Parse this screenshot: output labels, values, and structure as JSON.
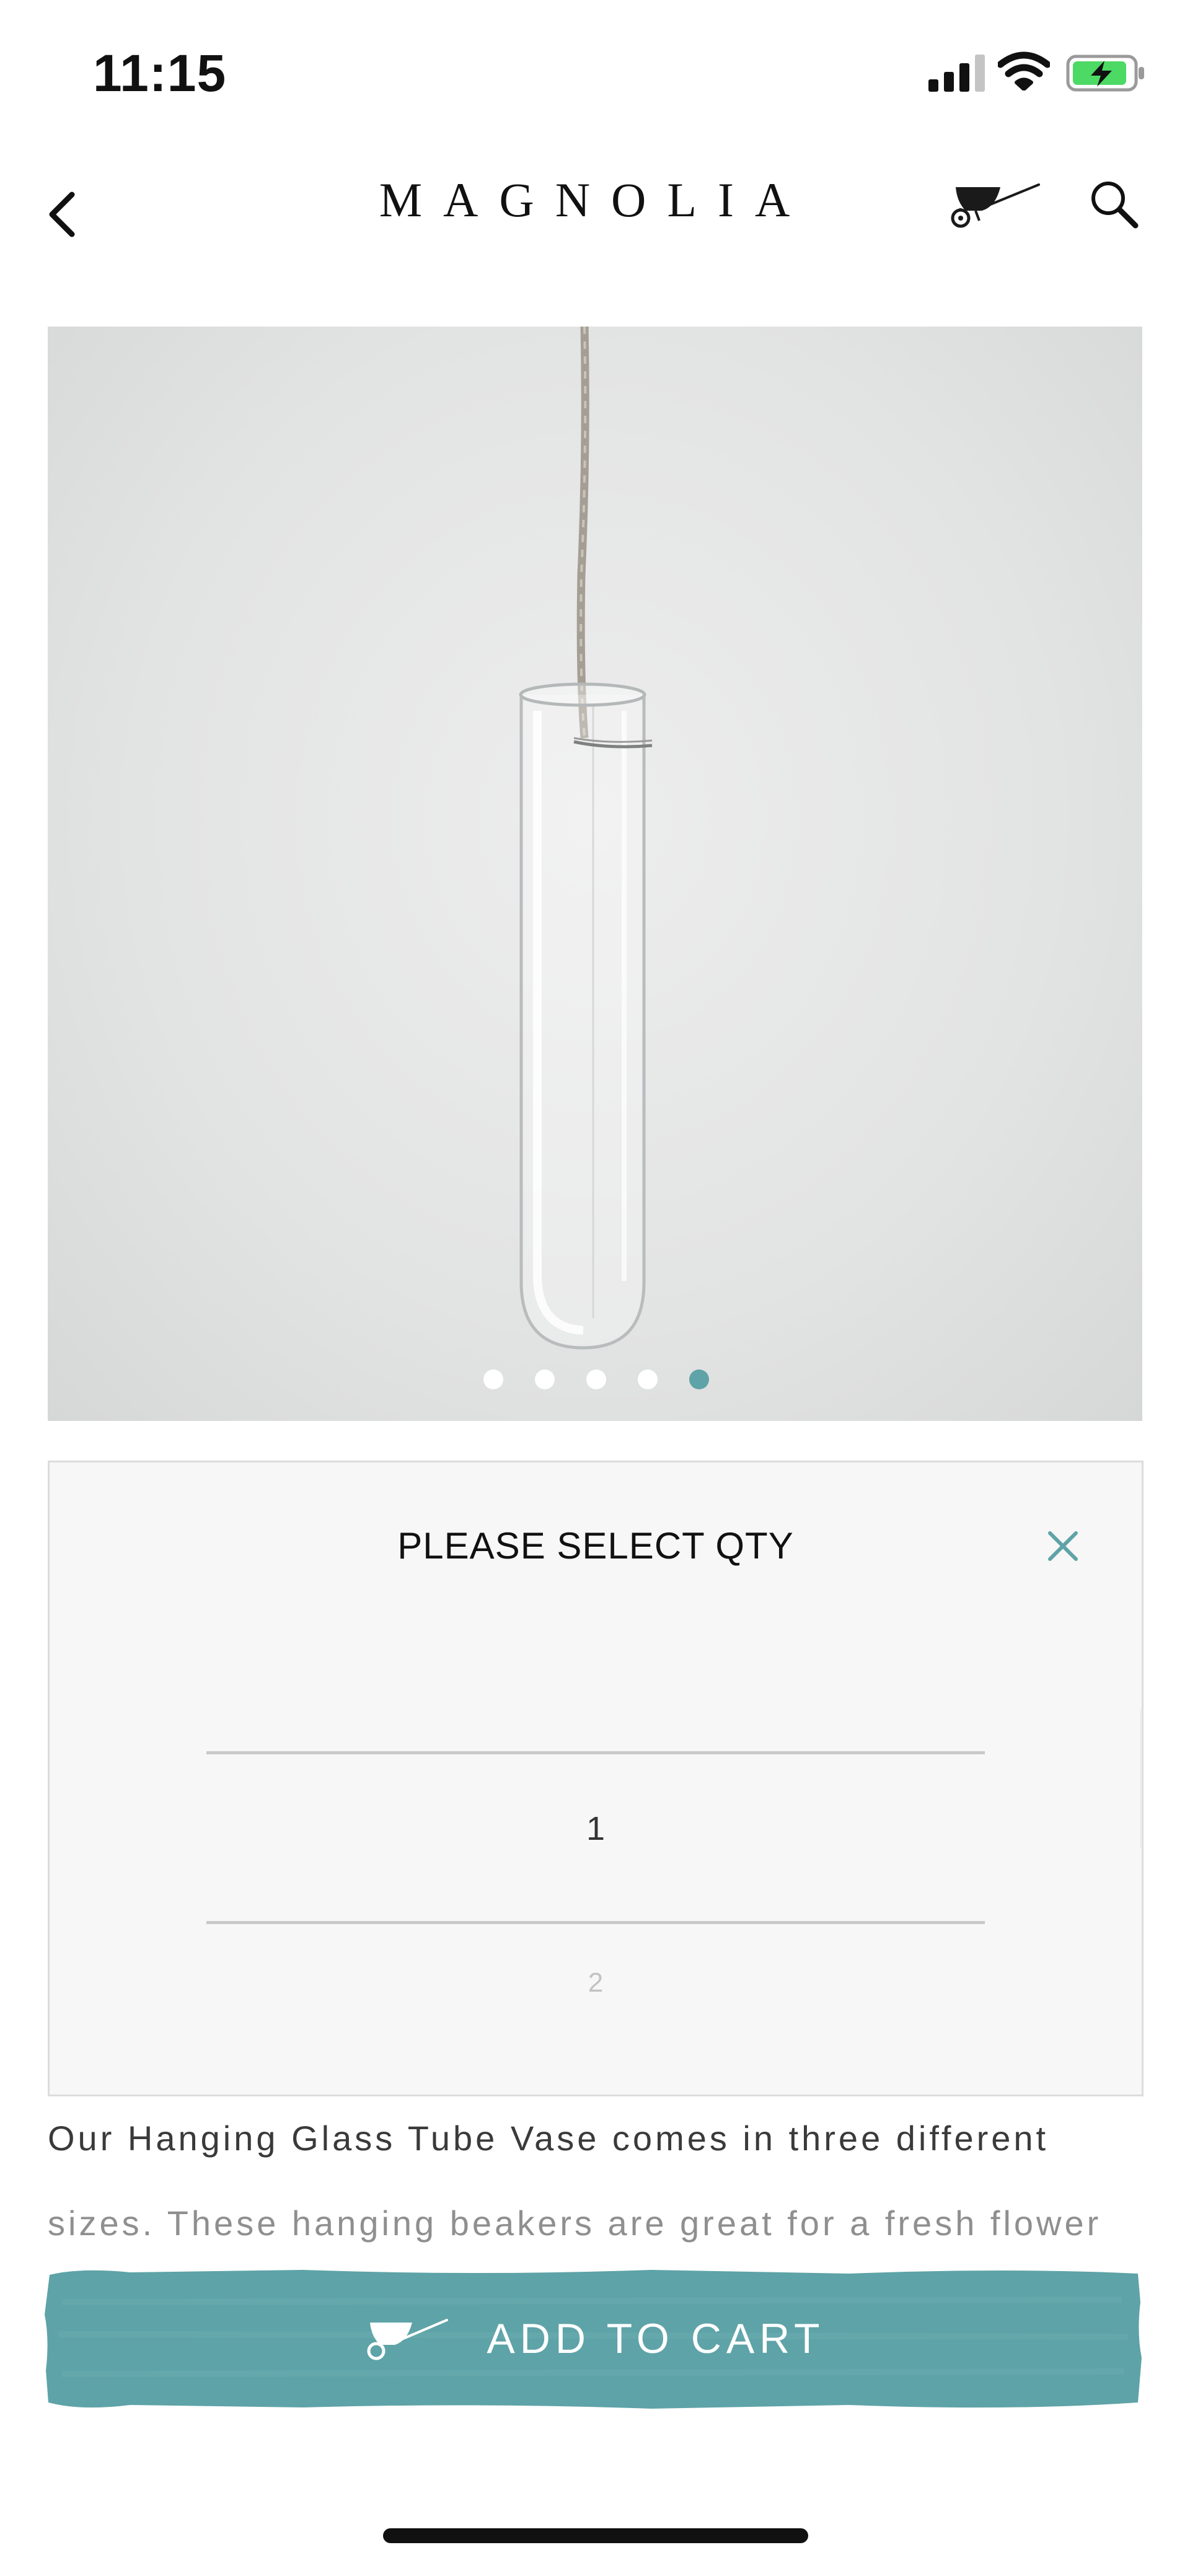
{
  "status_bar": {
    "time": "11:15"
  },
  "header": {
    "brand": "MAGNOLIA"
  },
  "product_image": {
    "carousel_total": 5,
    "carousel_active_index": 4,
    "colors": {
      "dot_active": "#5ea3a7",
      "dot_inactive": "#ffffff"
    }
  },
  "qty_picker": {
    "title": "PLEASE SELECT  QTY",
    "selected": "1",
    "next_option": "2"
  },
  "description": {
    "line1": "Our Hanging Glass Tube Vase comes in three different",
    "line2": "sizes. These hanging beakers are great for a fresh flower"
  },
  "cta": {
    "label": "ADD TO CART",
    "color": "#5ea3a7"
  }
}
